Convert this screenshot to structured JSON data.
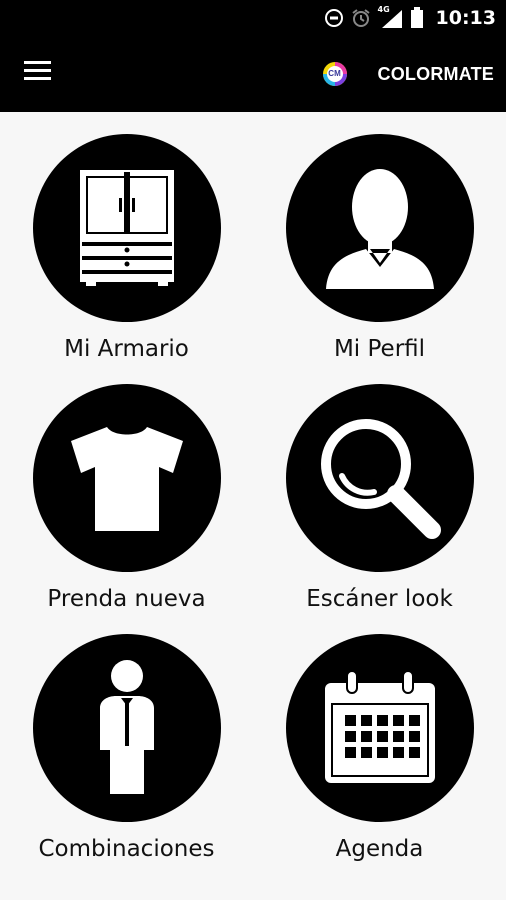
{
  "status_bar": {
    "time": "10:13",
    "network": "4G",
    "icons": [
      "sync-icon",
      "alarm-icon",
      "signal-icon",
      "battery-icon"
    ]
  },
  "app_bar": {
    "menu_icon": "hamburger-menu-icon",
    "logo_text": "CM",
    "title": "COLORMATE"
  },
  "menu": {
    "items": [
      {
        "label": "Mi Armario",
        "icon": "wardrobe-icon"
      },
      {
        "label": "Mi Perfil",
        "icon": "profile-icon"
      },
      {
        "label": "Prenda nueva",
        "icon": "tshirt-icon"
      },
      {
        "label": "Escáner look",
        "icon": "magnifier-icon"
      },
      {
        "label": "Combinaciones",
        "icon": "person-tie-icon"
      },
      {
        "label": "Agenda",
        "icon": "calendar-icon"
      }
    ]
  },
  "colors": {
    "bars": "#000000",
    "background": "#f7f7f7",
    "circle": "#000000",
    "icon": "#ffffff",
    "label": "#111111"
  }
}
